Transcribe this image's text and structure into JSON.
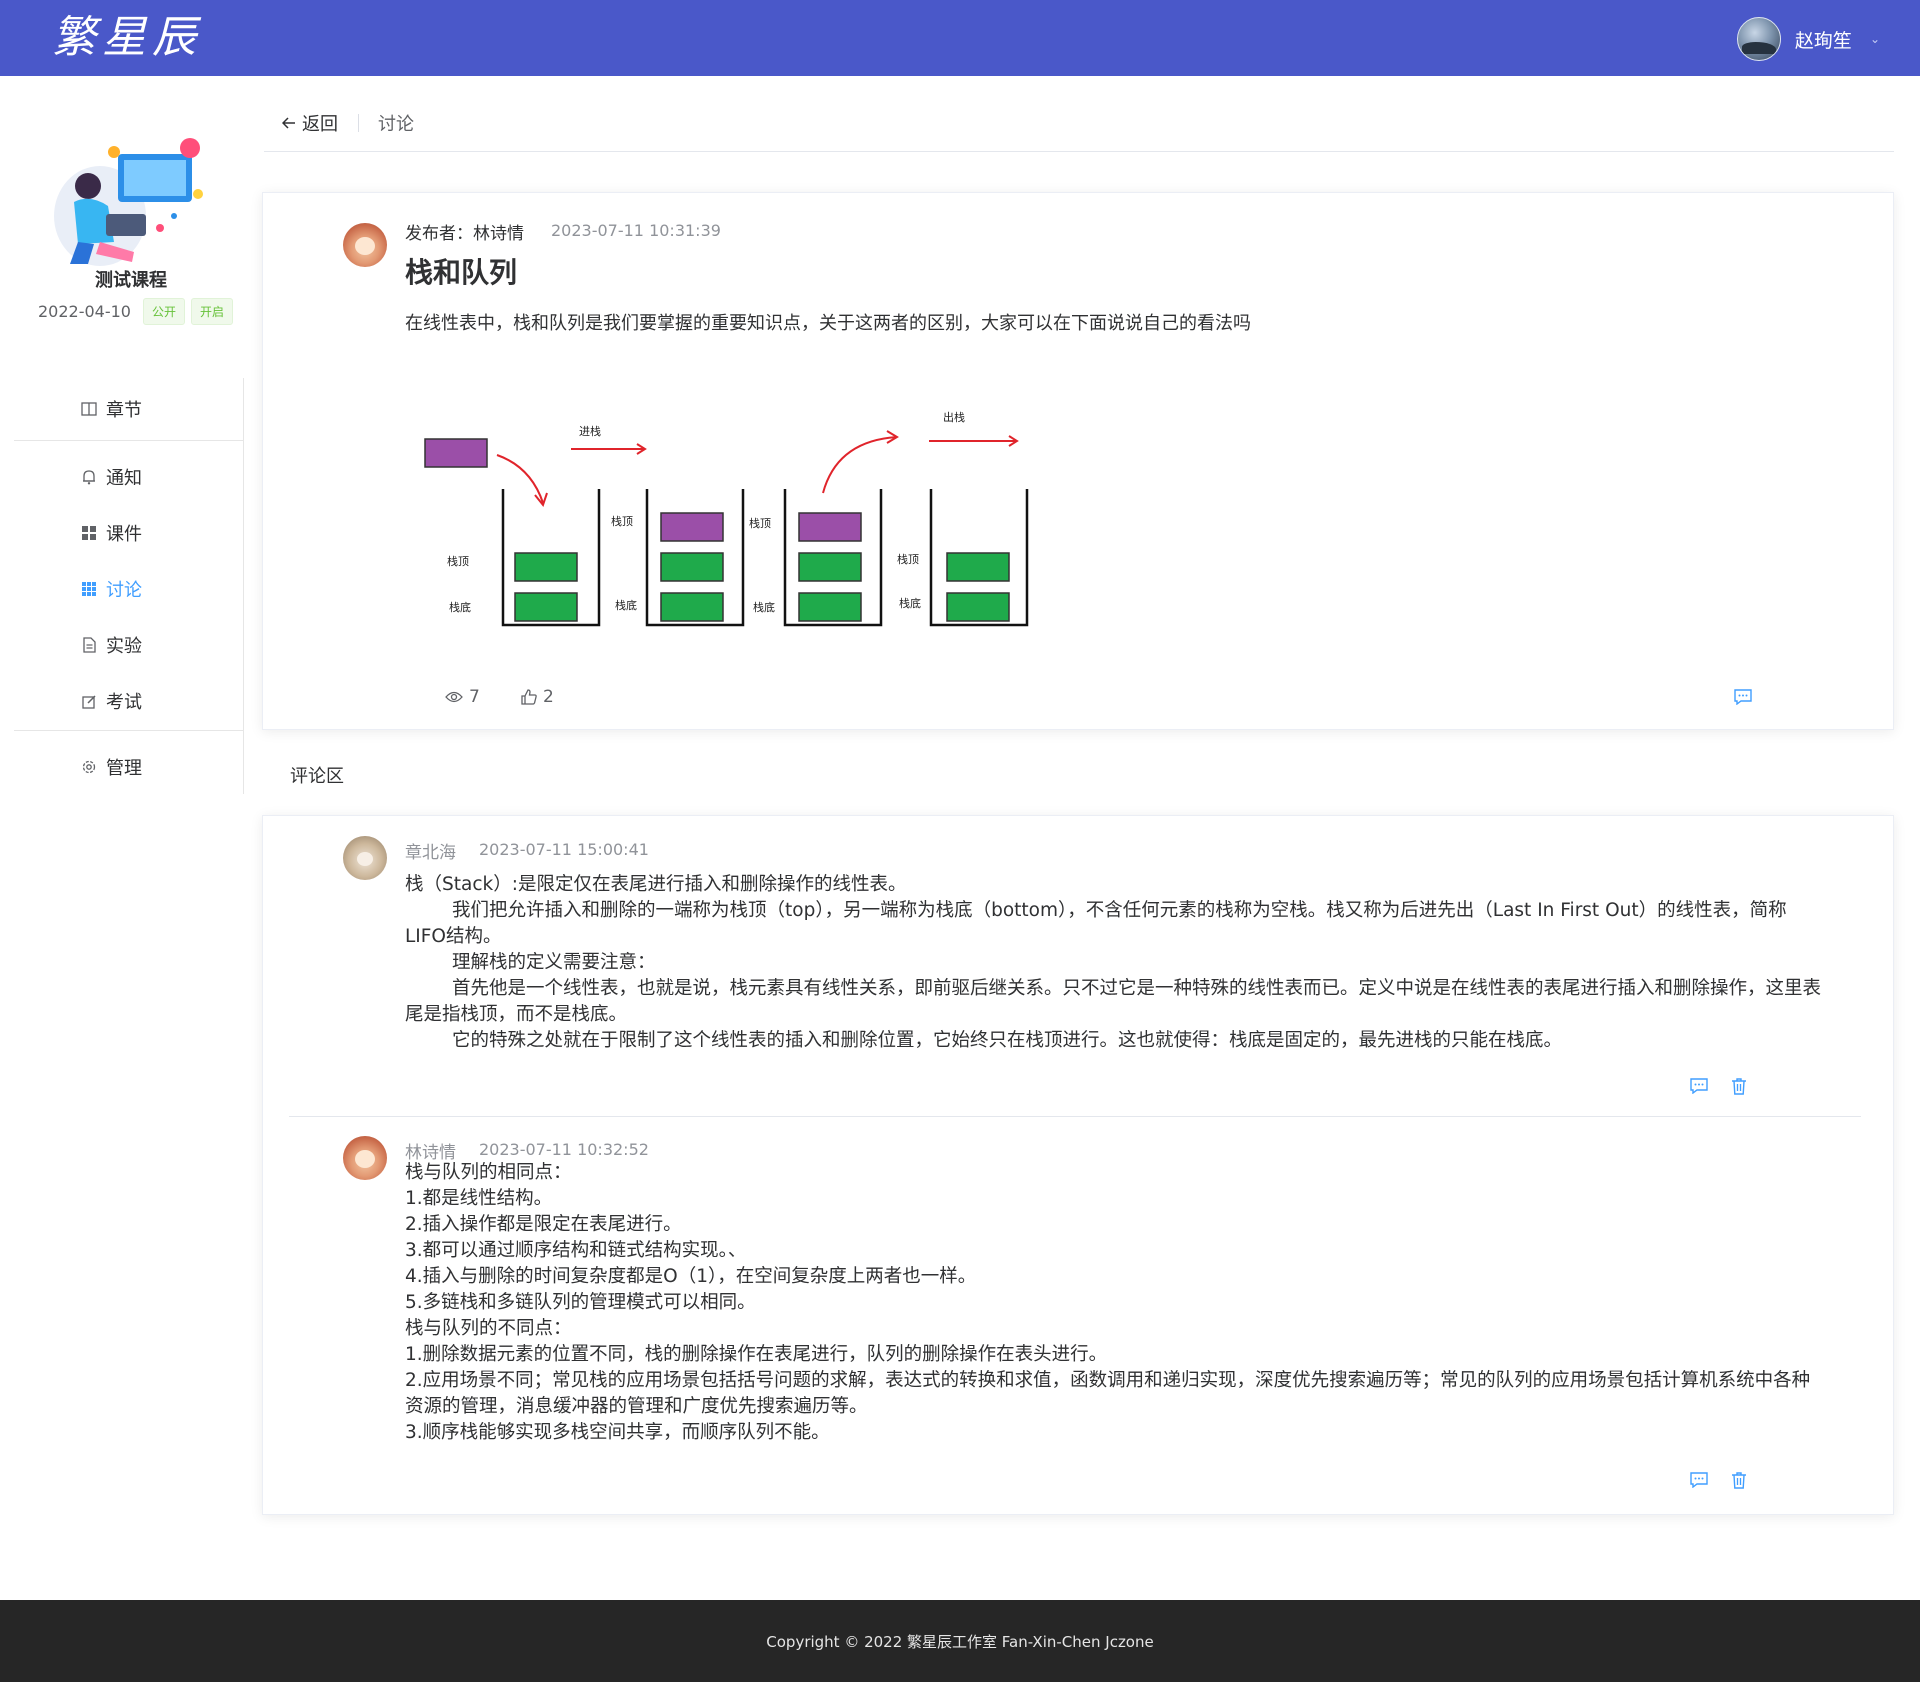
{
  "header": {
    "logo_text": "繁星辰",
    "user_name": "赵珣笙",
    "caret": "⌄"
  },
  "course": {
    "title": "测试课程",
    "date": "2022-04-10",
    "tag_public": "公开",
    "tag_open": "开启"
  },
  "menu": {
    "items": [
      {
        "label": "章节",
        "icon": "book-icon"
      },
      {
        "label": "通知",
        "icon": "bell-icon"
      },
      {
        "label": "课件",
        "icon": "grid-icon"
      },
      {
        "label": "讨论",
        "icon": "grid-dense-icon",
        "active": true
      },
      {
        "label": "实验",
        "icon": "document-icon"
      },
      {
        "label": "考试",
        "icon": "edit-icon"
      },
      {
        "label": "管理",
        "icon": "gear-icon"
      }
    ]
  },
  "pagehead": {
    "back_label": "返回",
    "title": "讨论"
  },
  "post": {
    "author_prefix": "发布者：",
    "author": "林诗情",
    "time": "2023-07-11 10:31:39",
    "title": "栈和队列",
    "content": "在线性表中，栈和队列是我们要掌握的重要知识点，关于这两者的区别，大家可以在下面说说自己的看法吗",
    "views": "7",
    "likes": "2",
    "diagram": {
      "push_label": "进栈",
      "pop_label": "出栈",
      "top_label": "栈顶",
      "bottom_label": "栈底"
    }
  },
  "comments_section": {
    "label": "评论区"
  },
  "comments": [
    {
      "name": "章北海",
      "time": "2023-07-11 15:00:41",
      "body": "栈（Stack）:是限定仅在表尾进行插入和删除操作的线性表。\n        我们把允许插入和删除的一端称为栈顶（top），另一端称为栈底（bottom），不含任何元素的栈称为空栈。栈又称为后进先出（Last In First Out）的线性表，简称LIFO结构。\n        理解栈的定义需要注意：\n        首先他是一个线性表，也就是说，栈元素具有线性关系，即前驱后继关系。只不过它是一种特殊的线性表而已。定义中说是在线性表的表尾进行插入和删除操作，这里表尾是指栈顶，而不是栈底。\n        它的特殊之处就在于限制了这个线性表的插入和删除位置，它始终只在栈顶进行。这也就使得：栈底是固定的，最先进栈的只能在栈底。"
    },
    {
      "name": "林诗情",
      "time": "2023-07-11 10:32:52",
      "body": "栈与队列的相同点：\n1.都是线性结构。\n2.插入操作都是限定在表尾进行。\n3.都可以通过顺序结构和链式结构实现。、\n4.插入与删除的时间复杂度都是O（1），在空间复杂度上两者也一样。\n5.多链栈和多链队列的管理模式可以相同。\n栈与队列的不同点：\n1.删除数据元素的位置不同，栈的删除操作在表尾进行，队列的删除操作在表头进行。\n2.应用场景不同；常见栈的应用场景包括括号问题的求解，表达式的转换和求值，函数调用和递归实现，深度优先搜索遍历等；常见的队列的应用场景包括计算机系统中各种资源的管理，消息缓冲器的管理和广度优先搜索遍历等。\n3.顺序栈能够实现多栈空间共享，而顺序队列不能。"
    }
  ],
  "footer": {
    "copyright": "Copyright © 2022 繁星辰工作室 Fan-Xin-Chen Jczone"
  },
  "colors": {
    "header_bg": "#4a58c9",
    "accent": "#409eff",
    "footer_bg": "#262626",
    "purple_block": "#9b4fa8",
    "green_block": "#1faa4b",
    "arrow_red": "#e0242b"
  }
}
